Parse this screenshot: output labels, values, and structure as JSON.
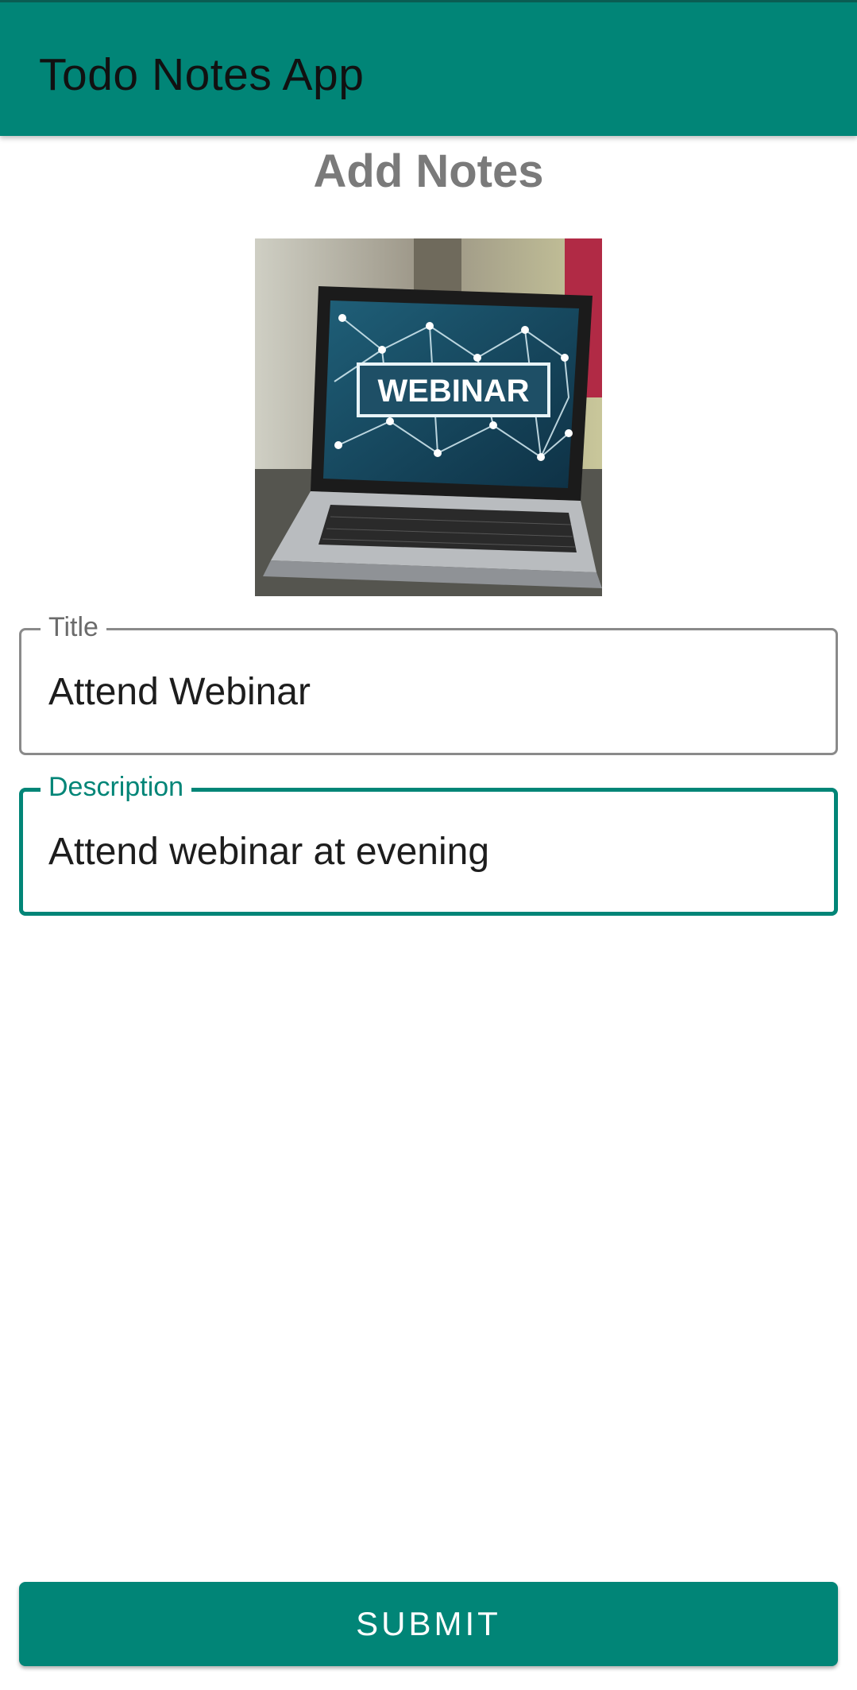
{
  "app_bar": {
    "title": "Todo Notes App"
  },
  "page": {
    "heading": "Add Notes"
  },
  "image": {
    "screen_text": "WEBINAR"
  },
  "form": {
    "title_field": {
      "label": "Title",
      "value": "Attend Webinar"
    },
    "description_field": {
      "label": "Description",
      "value": "Attend webinar at evening"
    },
    "submit_label": "SUBMIT"
  },
  "colors": {
    "primary": "#018577",
    "heading_gray": "#7a7a7a"
  }
}
